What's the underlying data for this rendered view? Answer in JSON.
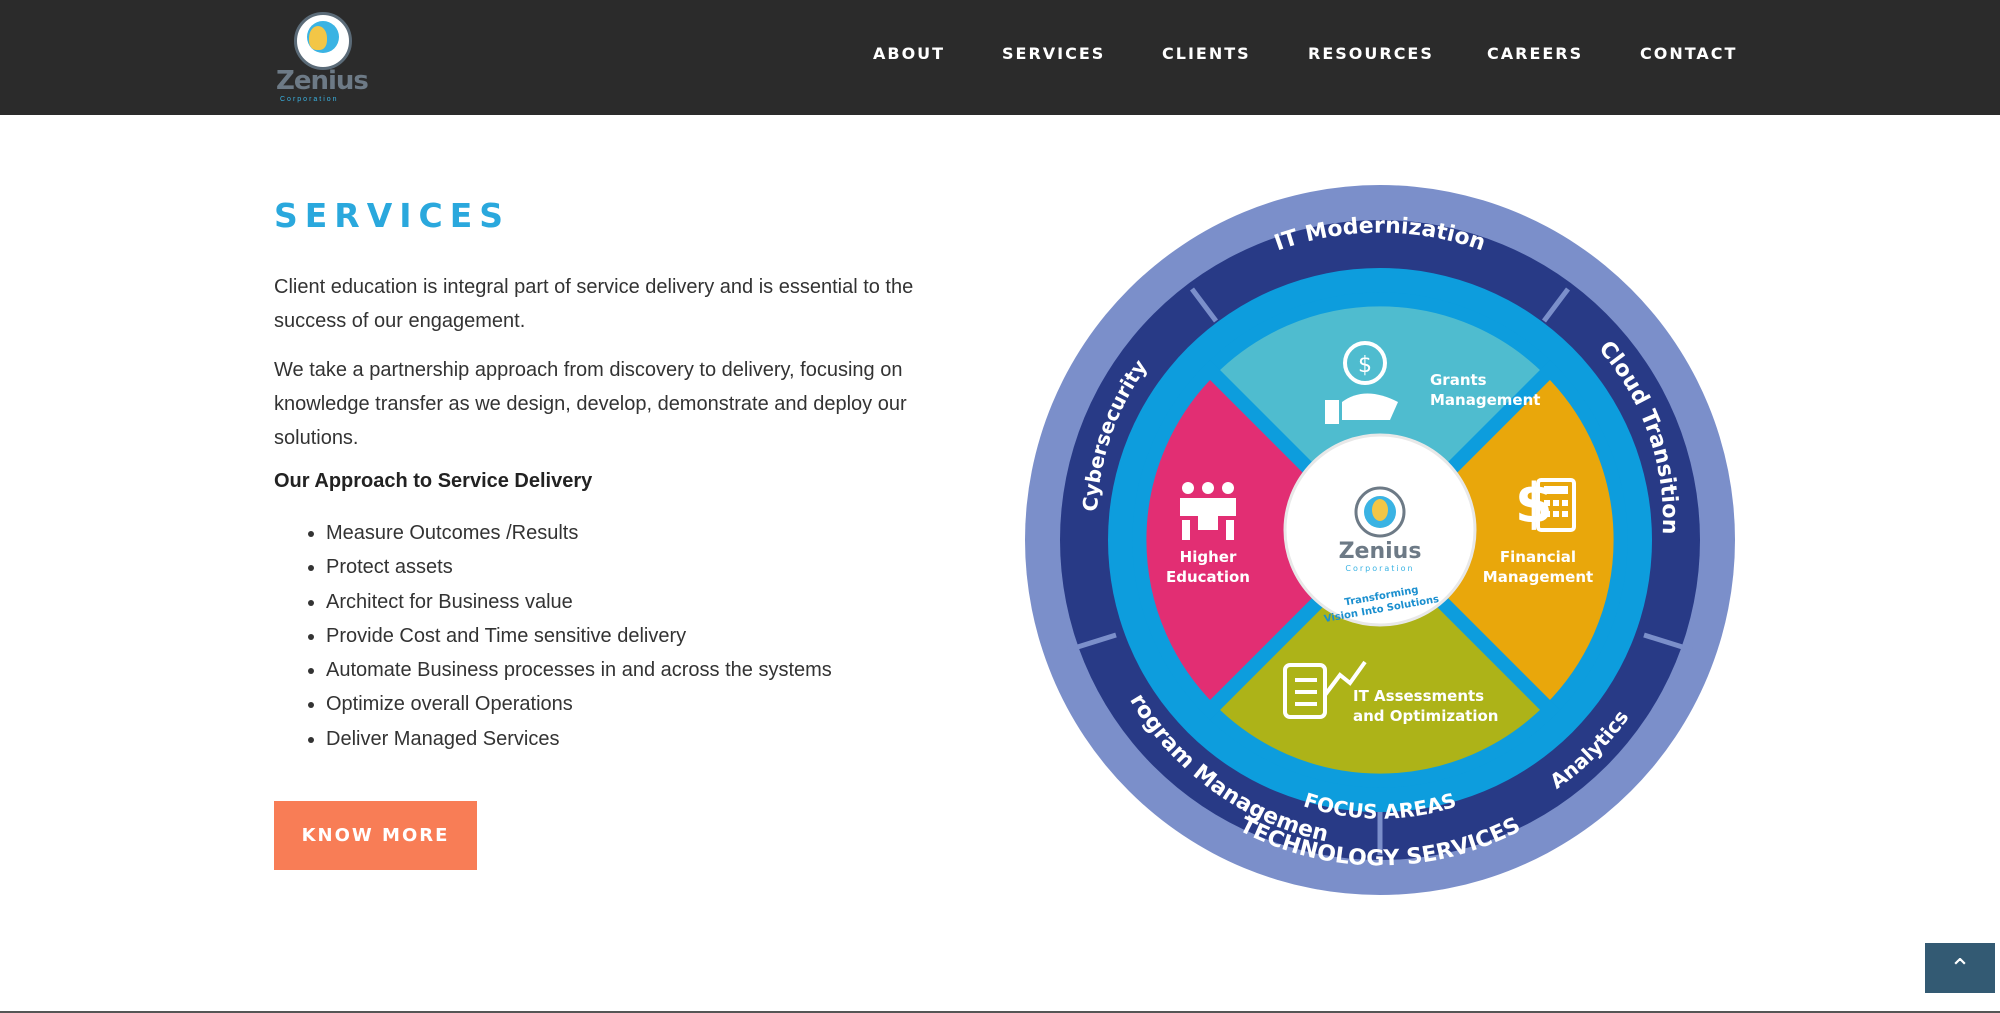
{
  "nav": {
    "logo_text": "Zenius",
    "logo_sub": "Corporation",
    "items": [
      "ABOUT",
      "SERVICES",
      "CLIENTS",
      "RESOURCES",
      "CAREERS",
      "CONTACT"
    ]
  },
  "main": {
    "title": "SERVICES",
    "paragraph1": "Client education is integral part of service delivery and is essential to the success of our engagement.",
    "paragraph2": "We take a partnership approach from discovery to delivery, focusing on knowledge transfer as we design, develop, demonstrate and deploy our solutions.",
    "approach_heading": "Our Approach to Service Delivery",
    "bullets": [
      "Measure Outcomes /Results",
      "Protect assets",
      "Architect for Business value",
      "Provide Cost and Time sensitive delivery",
      "Automate Business processes in and across the systems",
      "Optimize overall Operations",
      "Deliver Managed Services"
    ],
    "button_label": "KNOW MORE"
  },
  "wheel": {
    "outer_label": "TECHNOLOGY SERVICES",
    "ring_labels": [
      "IT Modernization",
      "Cloud Transition",
      "Analytics",
      "Program Management",
      "Cybersecurity"
    ],
    "inner_label": "FOCUS AREAS",
    "quadrants": {
      "top": [
        "Grants",
        "Management"
      ],
      "right": [
        "Financial",
        "Management"
      ],
      "bottom": [
        "IT Assessments",
        "and Optimization"
      ],
      "left": [
        "Higher",
        "Education"
      ]
    },
    "center_name": "Zenius",
    "center_sub": "Corporation",
    "center_tagline": [
      "Transforming",
      "Vision Into Solutions"
    ]
  },
  "colors": {
    "nav_bg": "#2b2b2b",
    "accent_blue": "#2aa8dd",
    "button": "#f87d56",
    "quad_top": "#4fbccf",
    "quad_right": "#e9a70b",
    "quad_bottom": "#adb318",
    "quad_left": "#e22e73"
  },
  "icons": {
    "back_to_top": "chevron-up-icon"
  }
}
